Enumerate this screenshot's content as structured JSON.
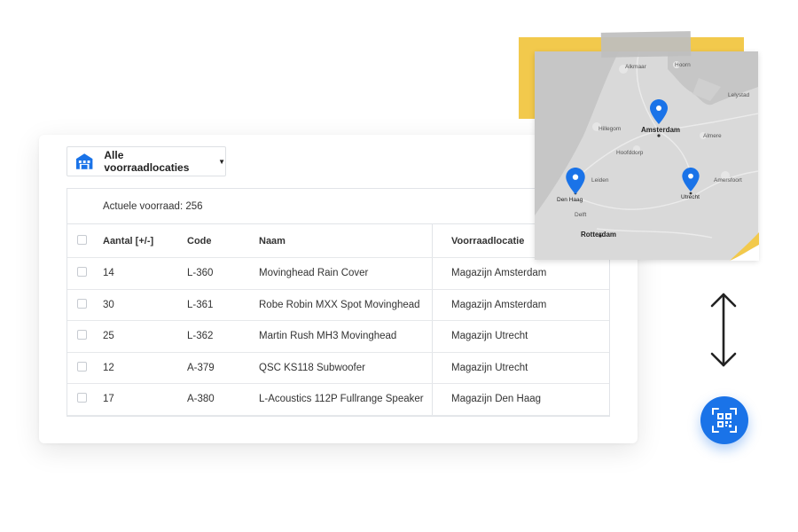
{
  "location_filter": {
    "label": "Alle voorraadlocaties",
    "icon": "warehouse-icon"
  },
  "stock_summary": {
    "text": "Actuele voorraad: 256"
  },
  "table": {
    "columns": [
      "Aantal [+/-]",
      "Code",
      "Naam",
      "Voorraadlocatie"
    ],
    "rows": [
      {
        "qty": "14",
        "code": "L-360",
        "name": "Movinghead Rain Cover",
        "location": "Magazijn Amsterdam"
      },
      {
        "qty": "30",
        "code": "L-361",
        "name": "Robe Robin MXX Spot Movinghead",
        "location": "Magazijn Amsterdam"
      },
      {
        "qty": "25",
        "code": "L-362",
        "name": "Martin Rush MH3 Movinghead",
        "location": "Magazijn Utrecht"
      },
      {
        "qty": "12",
        "code": "A-379",
        "name": "QSC KS118 Subwoofer",
        "location": "Magazijn Utrecht"
      },
      {
        "qty": "17",
        "code": "A-380",
        "name": "L-Acoustics 112P Fullrange Speaker",
        "location": "Magazijn Den Haag"
      }
    ]
  },
  "map": {
    "cities": [
      "Amsterdam",
      "Den Haag",
      "Rotterdam",
      "Utrecht"
    ],
    "places": [
      "Alkmaar",
      "Hoorn",
      "Lelystad",
      "Hillegom",
      "Hoofddorp",
      "Almere",
      "Amersfoort",
      "Leiden",
      "Delft"
    ]
  },
  "colors": {
    "accent": "#1a73e8",
    "note_yellow": "#f2c94c",
    "map_gray": "#dcdcdc"
  },
  "icons": {
    "scan": "qr-code-icon",
    "sync": "double-arrow-icon",
    "pin": "map-pin-icon"
  }
}
